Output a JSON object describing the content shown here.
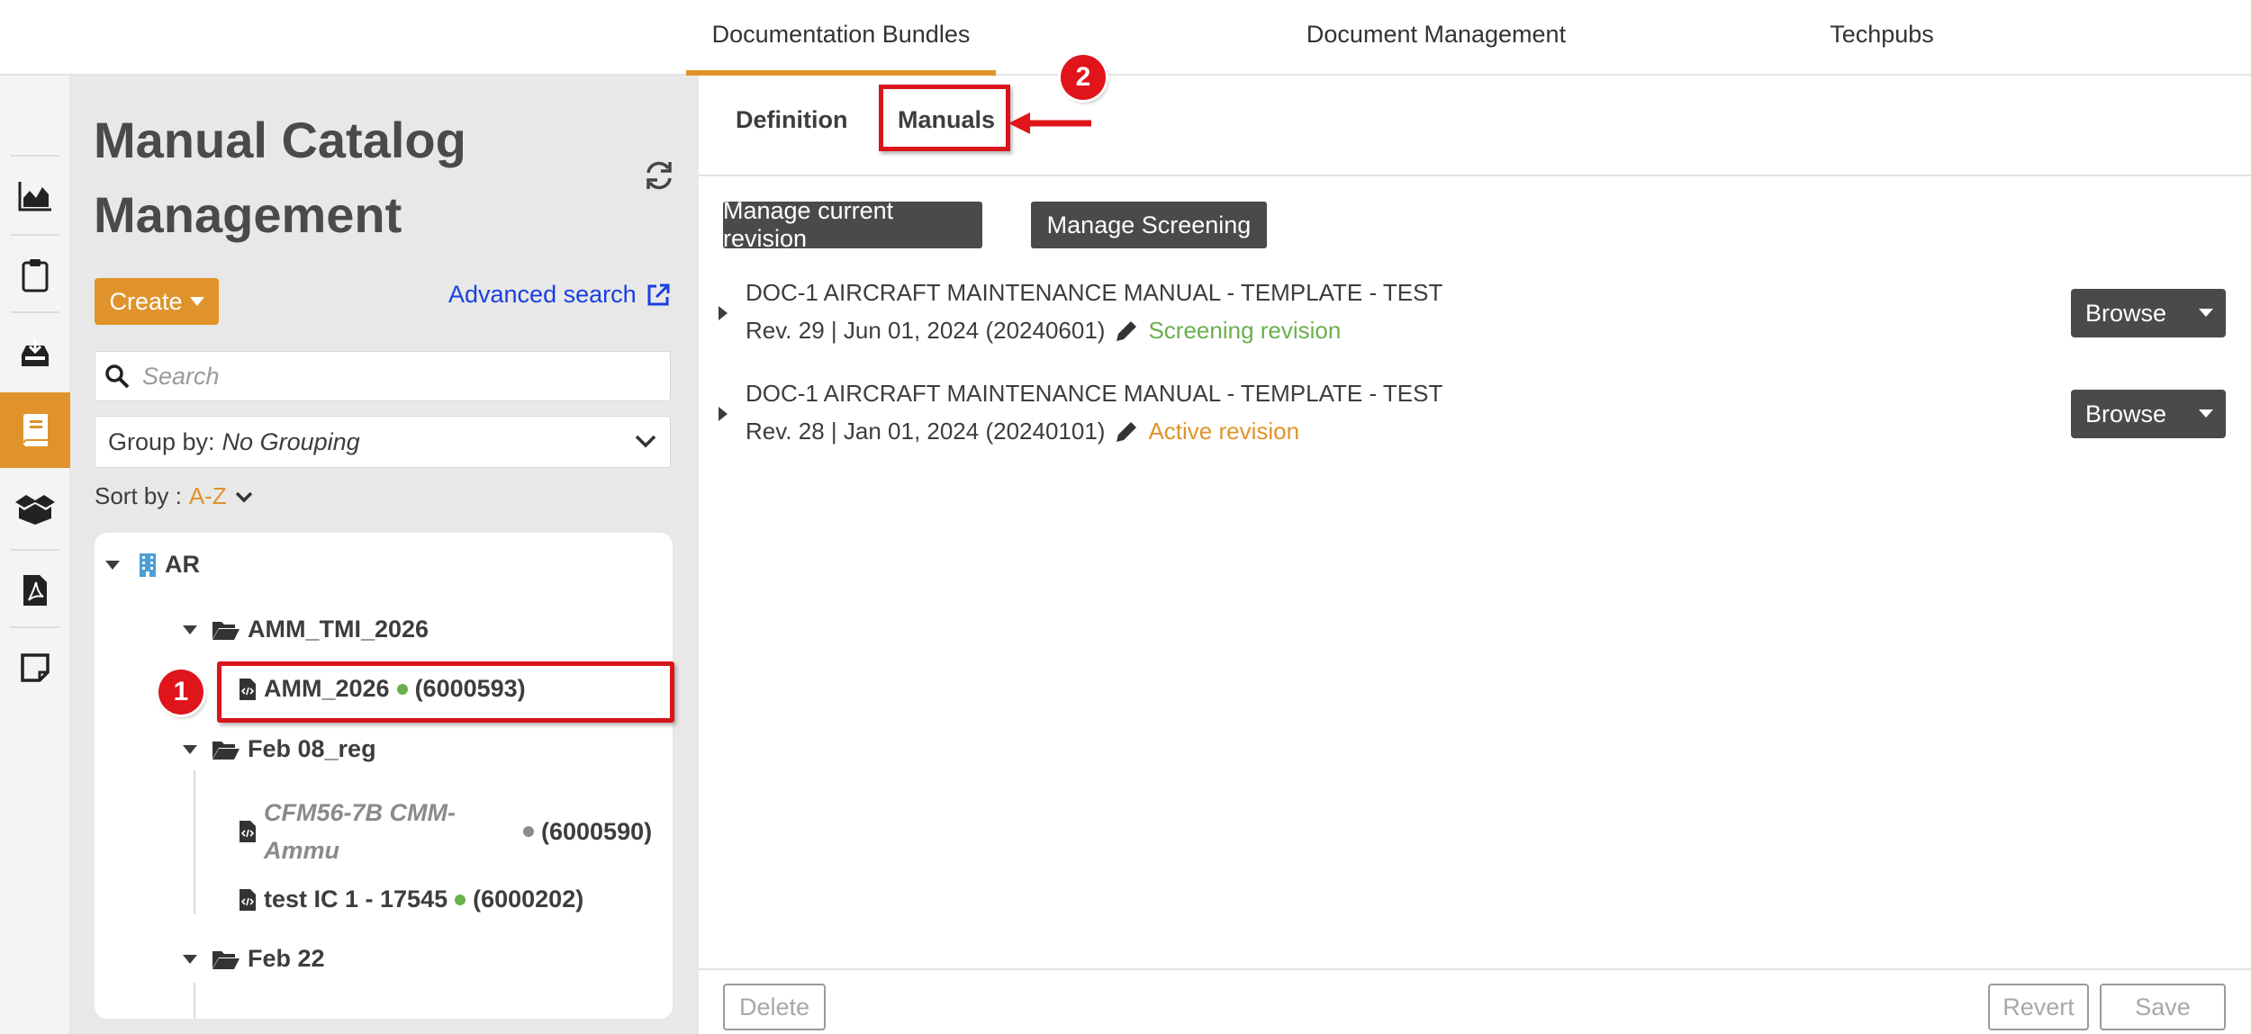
{
  "topnav": {
    "tabs": [
      {
        "label": "Documentation Bundles",
        "active": true
      },
      {
        "label": "Document Management",
        "active": false
      },
      {
        "label": "Techpubs",
        "active": false
      }
    ]
  },
  "rail": {
    "icons": [
      "chart-area-icon",
      "clipboard-icon",
      "inbox-download-icon",
      "book-icon",
      "box-open-icon",
      "file-pdf-icon",
      "sticky-note-icon"
    ],
    "active_icon": "book-icon"
  },
  "catalog": {
    "title": "Manual Catalog Management",
    "create_label": "Create",
    "advanced_search_label": "Advanced search",
    "search_placeholder": "Search",
    "group_by_label": "Group by:",
    "group_by_value": "No Grouping",
    "sort_by_label": "Sort by :",
    "sort_by_value": "A-Z",
    "tree": {
      "root": "AR",
      "folder1": "AMM_TMI_2026",
      "item1": {
        "name": "AMM_2026",
        "id": "(6000593)",
        "status_color": "#6ab04c"
      },
      "folder2": "Feb 08_reg",
      "item2": {
        "name_line1": "CFM56-7B CMM-",
        "name_line2": "Ammu",
        "id": "(6000590)",
        "status_color": "#8c8c8c"
      },
      "item3": {
        "name": "test IC 1 - 17545",
        "id": "(6000202)",
        "status_color": "#6ab04c"
      },
      "folder3": "Feb 22"
    }
  },
  "annotations": {
    "badge1": "1",
    "badge2": "2",
    "highlight_color": "#d9141b"
  },
  "detail": {
    "tabs": {
      "definition": "Definition",
      "manuals": "Manuals"
    },
    "buttons": {
      "manage_revision": "Manage current revision",
      "manage_screening": "Manage Screening"
    },
    "manuals": [
      {
        "title": "DOC-1 AIRCRAFT MAINTENANCE MANUAL - TEMPLATE - TEST",
        "revision": "Rev. 29 | Jun 01, 2024 (20240601)",
        "status": "Screening revision",
        "status_color": "#6ab04c",
        "browse_label": "Browse"
      },
      {
        "title": "DOC-1 AIRCRAFT MAINTENANCE MANUAL - TEMPLATE - TEST",
        "revision": "Rev. 28 | Jan 01, 2024 (20240101)",
        "status": "Active revision",
        "status_color": "#e0932a",
        "browse_label": "Browse"
      }
    ],
    "footer": {
      "delete": "Delete",
      "revert": "Revert",
      "save": "Save"
    }
  },
  "colors": {
    "accent": "#e0932a",
    "link": "#1a3fe0",
    "dark_button": "#4a4a4a"
  }
}
